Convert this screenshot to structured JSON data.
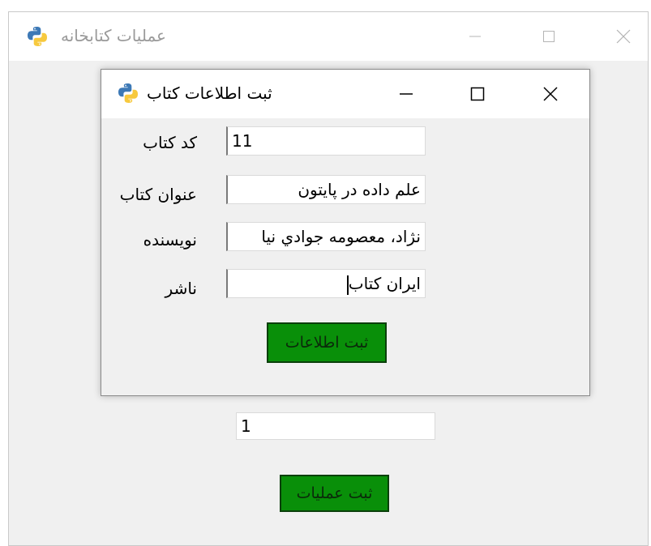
{
  "main_window": {
    "title": "عملیات کتابخانه",
    "input_value": "1",
    "submit_label": "ثبت عملیات"
  },
  "dialog": {
    "title": "ثبت اطلاعات کتاب",
    "fields": [
      {
        "label": "کد کتاب",
        "value": "11"
      },
      {
        "label": "عنوان کتاب",
        "value": "علم داده در پایتون"
      },
      {
        "label": "نویسنده",
        "value": "نژاد، معصومه جوادي نیا"
      },
      {
        "label": "ناشر",
        "value": "ایران کتاب"
      }
    ],
    "submit_label": "ثبت اطلاعات"
  },
  "window_controls": [
    "minimize-icon",
    "maximize-icon",
    "close-icon"
  ],
  "colors": {
    "button_green": "#098f09",
    "window_bg": "#f0f0f0",
    "inactive_title": "#9a9a9a"
  }
}
